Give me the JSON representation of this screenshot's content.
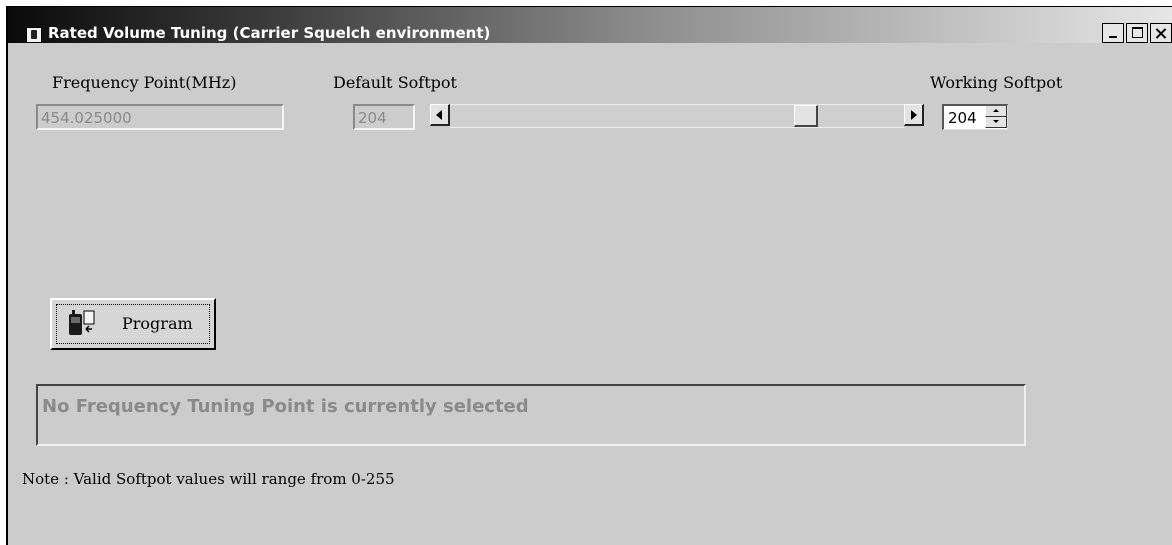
{
  "window": {
    "title": "Rated Volume Tuning (Carrier Squelch environment)"
  },
  "frequency": {
    "label": "Frequency Point(MHz)",
    "value": "454.025000"
  },
  "default_softpot": {
    "label": "Default Softpot",
    "value": "204",
    "slider_fraction": 0.8
  },
  "working_softpot": {
    "label": "Working Softpot",
    "value": "204"
  },
  "program_button": {
    "label": "Program",
    "icon": "radio-program-icon"
  },
  "status": {
    "text": "No Frequency Tuning Point is currently selected"
  },
  "note": {
    "text": "Note : Valid Softpot values will range from 0-255"
  },
  "colors": {
    "window_bg": "#cccccc",
    "disabled_text": "#8a8a8a"
  }
}
